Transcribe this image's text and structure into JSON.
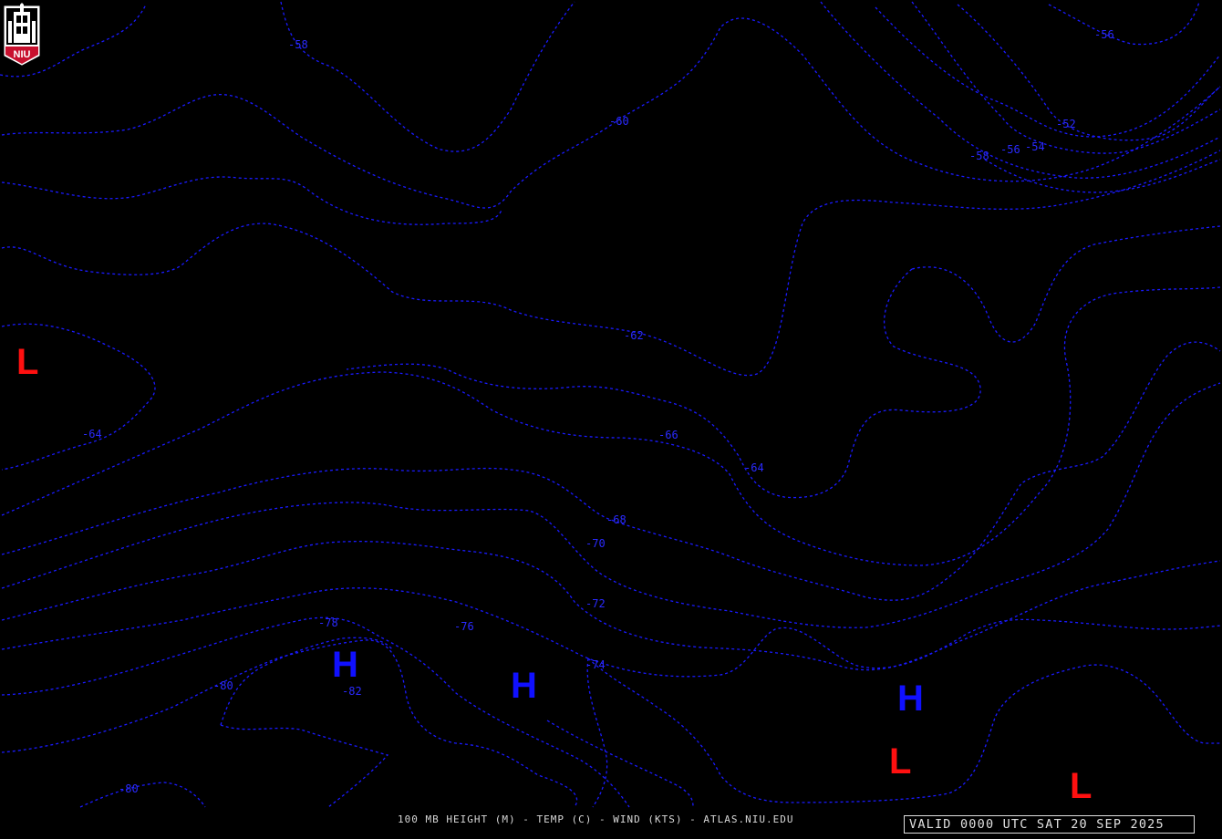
{
  "product": {
    "title": "100 MB HEIGHT (M) - TEMP (C) - WIND (KTS) - ATLAS.NIU.EDU",
    "valid_time": "VALID 0000 UTC SAT 20 SEP 2025"
  },
  "logo": {
    "text": "NIU",
    "accent_color": "#c8102e"
  },
  "colors": {
    "isotherm": "#1a1aff",
    "high": "#1010ff",
    "low": "#ff1010",
    "background": "#000000"
  },
  "isotherm_labels": [
    "-58",
    "-60",
    "-56",
    "-52",
    "-58",
    "-56",
    "-54",
    "-62",
    "-64",
    "-66",
    "-64",
    "-68",
    "-70",
    "-72",
    "-78",
    "-76",
    "-74",
    "-80",
    "-82",
    "-80"
  ],
  "pressure_centers": {
    "high_label": "H",
    "low_label": "L",
    "highs": [
      "H",
      "H",
      "H"
    ],
    "lows": [
      "L",
      "L",
      "L"
    ]
  }
}
